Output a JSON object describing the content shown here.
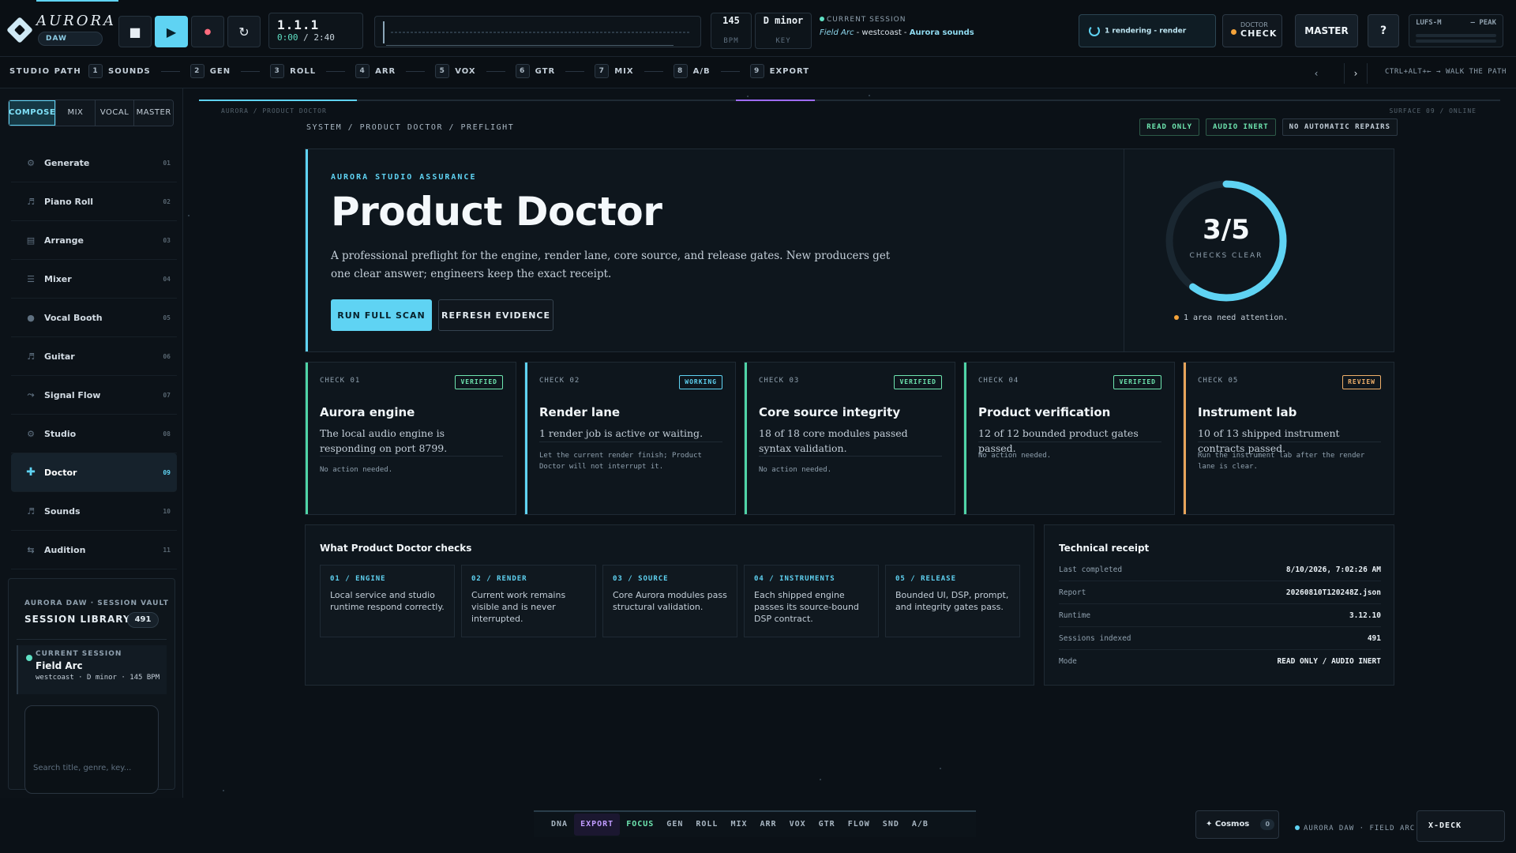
{
  "app": {
    "brand_name": "AURORA",
    "brand_sub": "DAW"
  },
  "transport": {
    "stop_icon": "stop-icon",
    "play_icon": "play-icon",
    "record_icon": "record-icon",
    "loop_icon": "loop-icon",
    "position": "1.1.1",
    "time_current": "0:00",
    "time_total": "/ 2:40",
    "bpm_value": "145",
    "bpm_label": "BPM",
    "key_value": "D minor",
    "key_label": "KEY"
  },
  "session_top": {
    "label": "CURRENT SESSION",
    "title": "Field Arc",
    "style": "- westcoast -",
    "sound": "Aurora sounds"
  },
  "top_actions": {
    "render_status": "1 rendering - render",
    "doctor_top": "DOCTOR",
    "doctor_bottom": "CHECK",
    "master": "MASTER",
    "help": "?",
    "meter_left": "LUFS-M",
    "meter_right": "– PEAK"
  },
  "studio_path": {
    "title": "STUDIO PATH",
    "steps": [
      {
        "n": "1",
        "label": "SOUNDS"
      },
      {
        "n": "2",
        "label": "GEN"
      },
      {
        "n": "3",
        "label": "ROLL"
      },
      {
        "n": "4",
        "label": "ARR"
      },
      {
        "n": "5",
        "label": "VOX"
      },
      {
        "n": "6",
        "label": "GTR"
      },
      {
        "n": "7",
        "label": "MIX"
      },
      {
        "n": "8",
        "label": "A/B"
      },
      {
        "n": "9",
        "label": "EXPORT"
      }
    ],
    "prev": "‹",
    "next": "›",
    "hint": "CTRL+ALT+← → WALK THE PATH"
  },
  "sidebar": {
    "modes": [
      "COMPOSE",
      "MIX",
      "VOCAL",
      "MASTER"
    ],
    "items": [
      {
        "label": "Generate",
        "num": "01",
        "icon": "⚙"
      },
      {
        "label": "Piano Roll",
        "num": "02",
        "icon": "♬"
      },
      {
        "label": "Arrange",
        "num": "03",
        "icon": "▤"
      },
      {
        "label": "Mixer",
        "num": "04",
        "icon": "☰"
      },
      {
        "label": "Vocal Booth",
        "num": "05",
        "icon": "●"
      },
      {
        "label": "Guitar",
        "num": "06",
        "icon": "♬"
      },
      {
        "label": "Signal Flow",
        "num": "07",
        "icon": "⤳"
      },
      {
        "label": "Studio",
        "num": "08",
        "icon": "⚙"
      },
      {
        "label": "Doctor",
        "num": "09",
        "icon": "✚"
      },
      {
        "label": "Sounds",
        "num": "10",
        "icon": "♬"
      },
      {
        "label": "Audition",
        "num": "11",
        "icon": "⇆"
      }
    ],
    "vault": {
      "crumb": "AURORA DAW · SESSION VAULT",
      "library": "SESSION LIBRARY",
      "count": "491",
      "current_label": "CURRENT SESSION",
      "current_name": "Field Arc",
      "current_meta": "westcoast · D minor · 145 BPM",
      "search_placeholder": "Search title, genre, key..."
    }
  },
  "main": {
    "micro_crumb": "AURORA / PRODUCT DOCTOR",
    "surface": "SURFACE 09 / ONLINE",
    "breadcrumb": "SYSTEM / PRODUCT DOCTOR / PREFLIGHT",
    "badges": [
      "READ ONLY",
      "AUDIO INERT",
      "NO AUTOMATIC REPAIRS"
    ],
    "hero": {
      "eyebrow": "AURORA STUDIO ASSURANCE",
      "title": "Product Doctor",
      "desc": "A professional preflight for the engine, render lane, core source, and release gates. New producers get one clear answer; engineers keep the exact receipt.",
      "btn_primary": "RUN FULL SCAN",
      "btn_secondary": "REFRESH EVIDENCE",
      "gauge_text": "3/5",
      "gauge_passed": 3,
      "gauge_total": 5,
      "gauge_label": "CHECKS CLEAR",
      "attention": "1 area need attention."
    },
    "checks": [
      {
        "id": "CHECK 01",
        "status": "VERIFIED",
        "title": "Aurora engine",
        "desc": "The local audio engine is responding on port 8799.",
        "note": "No action needed.",
        "accent": "#4fd4a6",
        "status_color": "#6ee6b0"
      },
      {
        "id": "CHECK 02",
        "status": "WORKING",
        "title": "Render lane",
        "desc": "1 render job is active or waiting.",
        "note": "Let the current render finish; Product Doctor will not interrupt it.",
        "accent": "#5fd3f3",
        "status_color": "#5fd3f3"
      },
      {
        "id": "CHECK 03",
        "status": "VERIFIED",
        "title": "Core source integrity",
        "desc": "18 of 18 core modules passed syntax validation.",
        "note": "No action needed.",
        "accent": "#4fd4a6",
        "status_color": "#6ee6b0"
      },
      {
        "id": "CHECK 04",
        "status": "VERIFIED",
        "title": "Product verification",
        "desc": "12 of 12 bounded product gates passed.",
        "note": "No action needed.",
        "accent": "#4fd4a6",
        "status_color": "#6ee6b0"
      },
      {
        "id": "CHECK 05",
        "status": "REVIEW",
        "title": "Instrument lab",
        "desc": "10 of 13 shipped instrument contracts passed.",
        "note": "Run the instrument lab after the render lane is clear.",
        "accent": "#e8a45a",
        "status_color": "#f0b06a"
      }
    ],
    "what": {
      "title": "What Product Doctor checks",
      "items": [
        {
          "head": "01 / ENGINE",
          "desc": "Local service and studio runtime respond correctly."
        },
        {
          "head": "02 / RENDER",
          "desc": "Current work remains visible and is never interrupted."
        },
        {
          "head": "03 / SOURCE",
          "desc": "Core Aurora modules pass structural validation."
        },
        {
          "head": "04 / INSTRUMENTS",
          "desc": "Each shipped engine passes its source-bound DSP contract."
        },
        {
          "head": "05 / RELEASE",
          "desc": "Bounded UI, DSP, prompt, and integrity gates pass."
        }
      ]
    },
    "receipt": {
      "title": "Technical receipt",
      "rows": [
        {
          "k": "Last completed",
          "v": "8/10/2026, 7:02:26 AM"
        },
        {
          "k": "Report",
          "v": "20260810T120248Z.json"
        },
        {
          "k": "Runtime",
          "v": "3.12.10"
        },
        {
          "k": "Sessions indexed",
          "v": "491"
        },
        {
          "k": "Mode",
          "v": "READ ONLY / AUDIO INERT"
        }
      ]
    }
  },
  "dock": {
    "items": [
      "DNA",
      "EXPORT",
      "FOCUS",
      "GEN",
      "ROLL",
      "MIX",
      "ARR",
      "VOX",
      "GTR",
      "FLOW",
      "SND",
      "A/B"
    ],
    "cosmos": "✦ Cosmos",
    "cosmos_count": "0",
    "status": "AURORA DAW · FIELD ARC",
    "xdeck": "X-DECK"
  },
  "colors": {
    "accent": "#5fd3f3",
    "verified": "#6ee6b0",
    "review": "#f0b06a",
    "background": "#0b1117"
  }
}
